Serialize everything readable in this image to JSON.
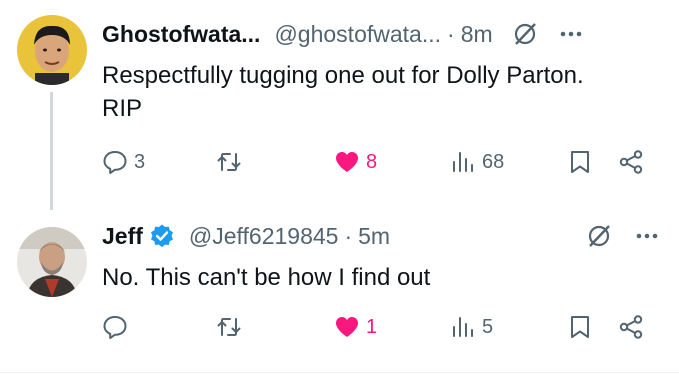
{
  "posts": [
    {
      "display_name": "Ghostofwata...",
      "handle": "@ghostofwata...",
      "separator": "·",
      "time": "8m",
      "text_lines": [
        "Respectfully tugging one out for Dolly Parton.",
        "RIP"
      ],
      "verified": false,
      "liked": true,
      "stats": {
        "replies": "3",
        "reposts": "",
        "likes": "8",
        "views": "68"
      },
      "icons": [
        "grok-icon",
        "more-icon",
        "reply-icon",
        "repost-icon",
        "heart-icon",
        "views-icon",
        "bookmark-icon",
        "share-icon"
      ]
    },
    {
      "display_name": "Jeff",
      "handle": "@Jeff6219845",
      "separator": "·",
      "time": "5m",
      "text_lines": [
        "No. This can't be how I find out"
      ],
      "verified": true,
      "liked": true,
      "stats": {
        "replies": "",
        "reposts": "",
        "likes": "1",
        "views": "5"
      },
      "icons": [
        "verified-badge-icon",
        "grok-icon",
        "more-icon",
        "reply-icon",
        "repost-icon",
        "heart-icon",
        "views-icon",
        "bookmark-icon",
        "share-icon"
      ]
    }
  ],
  "colors": {
    "like_active": "#f91880",
    "secondary_text": "#536471",
    "primary_text": "#0f1419",
    "verified_blue": "#1d9bf0",
    "thread_line": "#cfd9de"
  }
}
